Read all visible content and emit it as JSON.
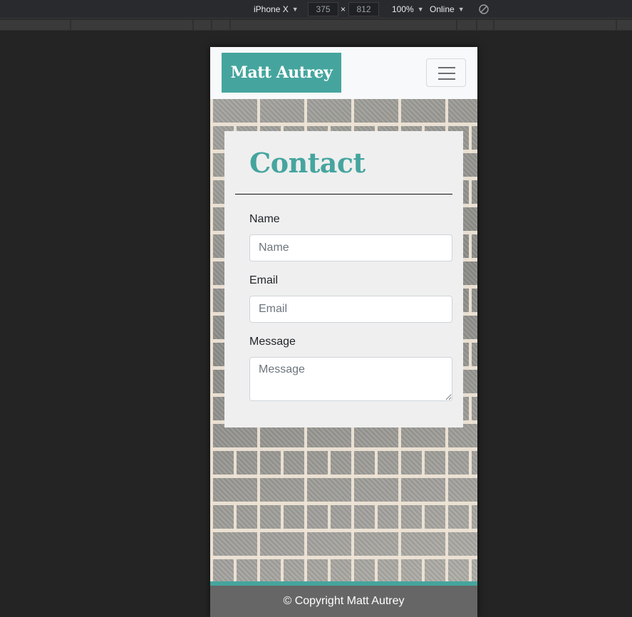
{
  "devtools": {
    "device": "iPhone X",
    "width": "375",
    "separator": "×",
    "height": "812",
    "zoom": "100%",
    "network": "Online",
    "rotate_icon": "rotate-icon"
  },
  "site": {
    "brand": "Matt Autrey",
    "menu_icon": "hamburger-icon"
  },
  "contact": {
    "title": "Contact",
    "name_label": "Name",
    "name_placeholder": "Name",
    "email_label": "Email",
    "email_placeholder": "Email",
    "message_label": "Message",
    "message_placeholder": "Message"
  },
  "footer": {
    "text": "© Copyright Matt Autrey"
  },
  "colors": {
    "accent": "#45a59e",
    "footer_bg": "#666666",
    "card_bg": "#efefef",
    "devtools_bg": "#242424"
  }
}
